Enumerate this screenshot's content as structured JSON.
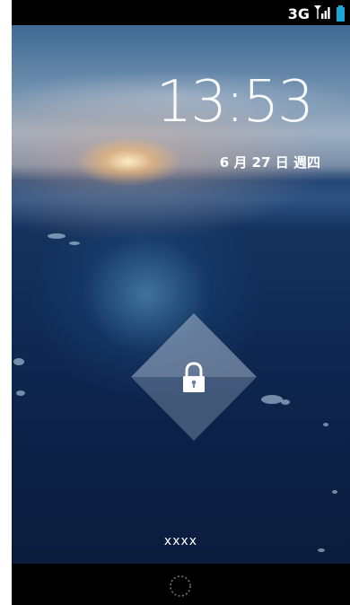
{
  "status_bar": {
    "network": "3G",
    "icons": [
      "signal-icon",
      "battery-icon"
    ],
    "battery_color": "#1fa4d8"
  },
  "lockscreen": {
    "time": "13:53",
    "date": "6 月 27 日 週四",
    "owner_text": "xxxx",
    "unlock_icon": "padlock-icon"
  },
  "nav_bar": {
    "home_icon": "home-ring-icon"
  }
}
